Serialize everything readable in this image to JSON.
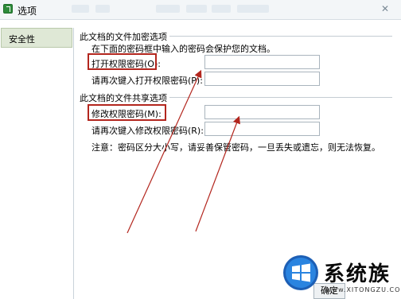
{
  "window": {
    "title": "选项",
    "close_symbol": "✕"
  },
  "sidebar": {
    "items": [
      {
        "label": "安全性",
        "selected": true
      }
    ]
  },
  "encryption": {
    "group_title": "此文档的文件加密选项",
    "description": "在下面的密码框中输入的密码会保护您的文档。",
    "open_password_label": "打开权限密码(O):",
    "open_password_value": "",
    "open_confirm_label": "请再次键入打开权限密码(P):",
    "open_confirm_value": ""
  },
  "sharing": {
    "group_title": "此文档的文件共享选项",
    "modify_password_label": "修改权限密码(M):",
    "modify_password_value": "",
    "modify_confirm_label": "请再次键入修改权限密码(R):",
    "modify_confirm_value": "",
    "note": "注意：密码区分大小写，请妥善保管密码，一旦丢失或遗忘，则无法恢复。"
  },
  "footer": {
    "ok_label": "确定"
  },
  "annotations": {
    "highlight_color": "#b3261e",
    "arrow_color": "#b3261e"
  },
  "watermark": {
    "brand": "系统族",
    "url": "www.XITONGZU.COM",
    "logo": "windows-logo-icon"
  }
}
